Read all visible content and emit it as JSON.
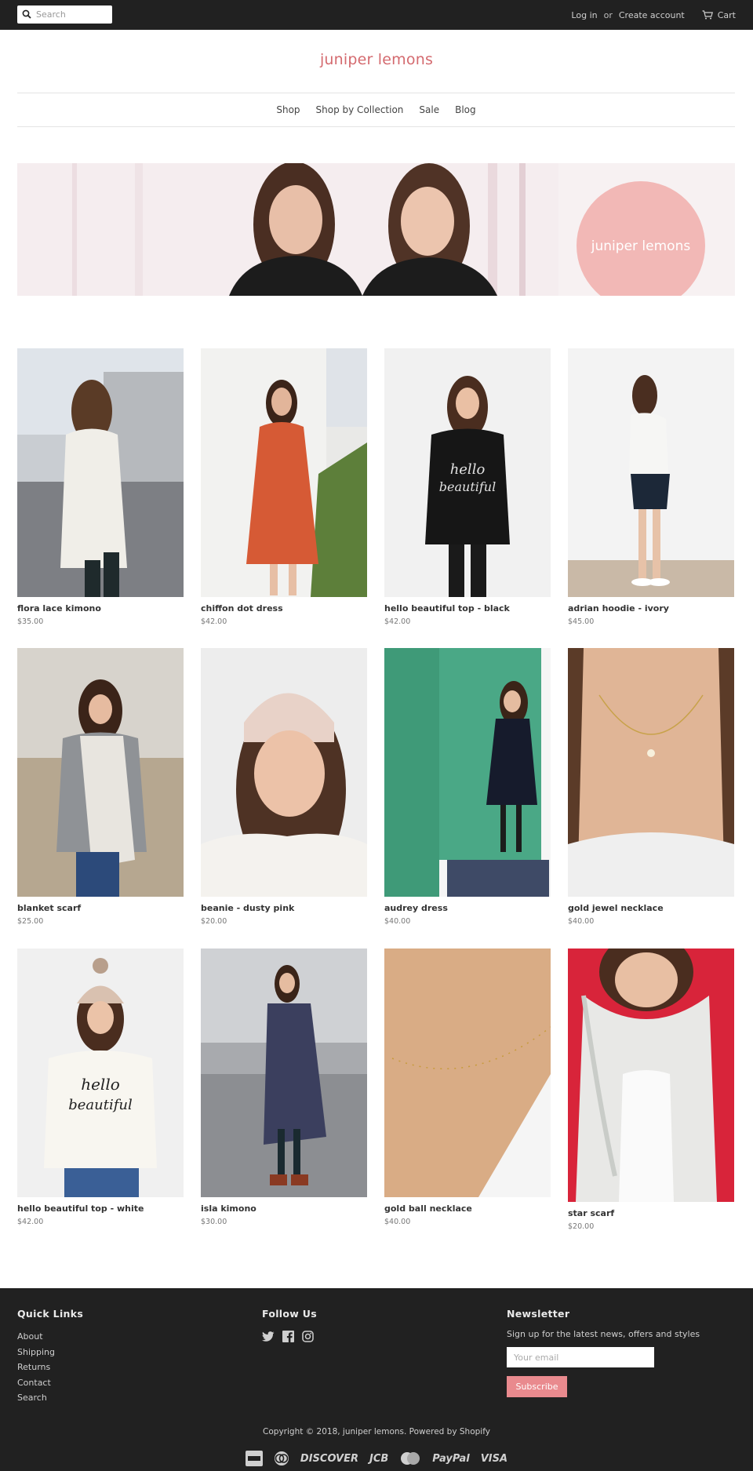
{
  "topbar": {
    "search_placeholder": "Search",
    "login": "Log in",
    "or": "or",
    "create_account": "Create account",
    "cart": "Cart"
  },
  "header": {
    "logo": "juniper lemons"
  },
  "nav": {
    "items": [
      "Shop",
      "Shop by Collection",
      "Sale",
      "Blog"
    ]
  },
  "hero": {
    "badge_text": "juniper lemons"
  },
  "products": [
    {
      "name": "flora lace kimono",
      "price": "$35.00"
    },
    {
      "name": "chiffon dot dress",
      "price": "$42.00"
    },
    {
      "name": "hello beautiful top - black",
      "price": "$42.00"
    },
    {
      "name": "adrian hoodie - ivory",
      "price": "$45.00"
    },
    {
      "name": "blanket scarf",
      "price": "$25.00"
    },
    {
      "name": "beanie - dusty pink",
      "price": "$20.00"
    },
    {
      "name": "audrey dress",
      "price": "$40.00"
    },
    {
      "name": "gold jewel necklace",
      "price": "$40.00"
    },
    {
      "name": "hello beautiful top - white",
      "price": "$42.00"
    },
    {
      "name": "isla kimono",
      "price": "$30.00"
    },
    {
      "name": "gold ball necklace",
      "price": "$40.00"
    },
    {
      "name": "star scarf",
      "price": "$20.00"
    }
  ],
  "footer": {
    "quick_links_title": "Quick Links",
    "quick_links": [
      "About",
      "Shipping",
      "Returns",
      "Contact",
      "Search"
    ],
    "follow_title": "Follow Us",
    "social_icons": [
      "twitter-icon",
      "facebook-icon",
      "instagram-icon"
    ],
    "newsletter_title": "Newsletter",
    "newsletter_text": "Sign up for the latest news, offers and styles",
    "email_placeholder": "Your email",
    "subscribe": "Subscribe",
    "copyright": "Copyright © 2018, juniper lemons. Powered by Shopify",
    "payments": [
      "amex-icon",
      "diners-icon",
      "DISCOVER",
      "JCB",
      "mastercard-icon",
      "PayPal",
      "VISA"
    ]
  },
  "colors": {
    "topbar_bg": "#212121",
    "brand_pink": "#d46a6f",
    "subscribe_bg": "#e98a8e"
  }
}
